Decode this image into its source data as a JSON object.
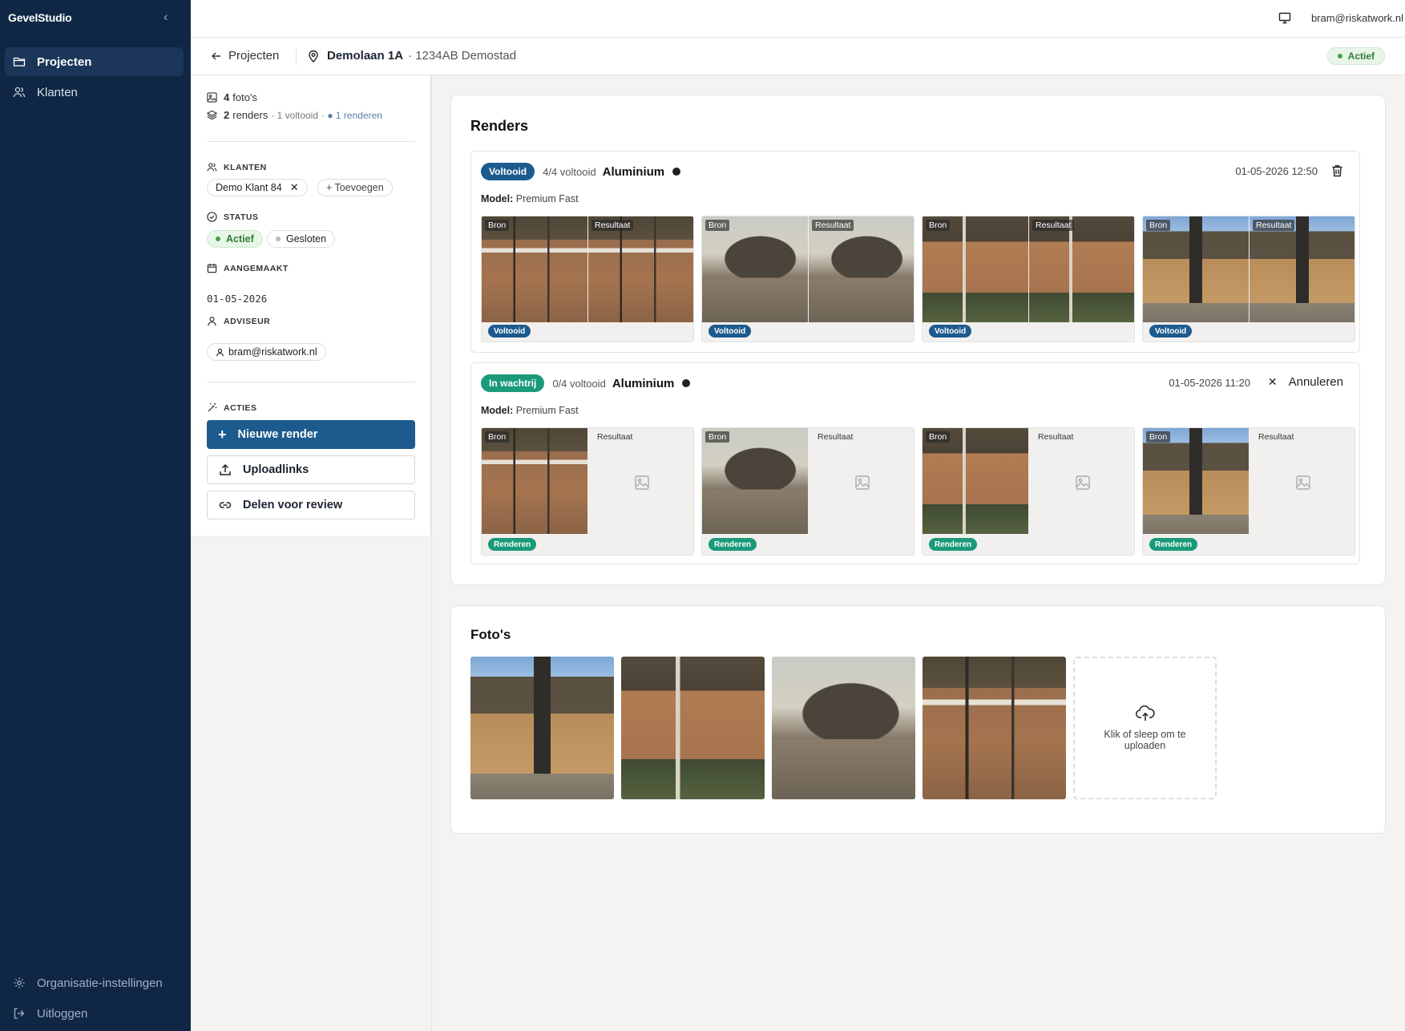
{
  "app": {
    "brand": "GevelStudio"
  },
  "sidebar": {
    "items": [
      {
        "label": "Projecten",
        "icon": "folder-icon",
        "active": true
      },
      {
        "label": "Klanten",
        "icon": "users-icon",
        "active": false
      }
    ],
    "bottom": [
      {
        "label": "Organisatie-instellingen",
        "icon": "gear-icon"
      },
      {
        "label": "Uitloggen",
        "icon": "logout-icon"
      }
    ]
  },
  "topbar": {
    "user_email": "bram@riskatwork.nl",
    "icon": "monitor-icon"
  },
  "breadcrumb": {
    "back_label": "Projecten",
    "address": "Demolaan 1A",
    "postal": "· 1234AB Demostad",
    "status": "Actief"
  },
  "info": {
    "photos_count": "4",
    "photos_label": "foto's",
    "renders_count": "2",
    "renders_label": "renders",
    "renders_done": "· 1 voltooid",
    "renders_busy": "· ● 1 renderen",
    "klanten_label": "KLANTEN",
    "klant_chip": "Demo Klant 84",
    "add_label": "+ Toevoegen",
    "status_label": "STATUS",
    "status_active": "Actief",
    "status_closed": "Gesloten",
    "created_label": "AANGEMAAKT",
    "created_value": "01-05-2026",
    "advisor_label": "ADVISEUR",
    "advisor_value": "bram@riskatwork.nl",
    "actions_label": "ACTIES",
    "action_new": "Nieuwe render",
    "action_upload": "Uploadlinks",
    "action_share": "Delen voor review"
  },
  "renders": {
    "title": "Renders",
    "blocks": [
      {
        "status": "Voltooid",
        "status_color": "#1d5b8f",
        "count": "4/4 voltooid",
        "material": "Aluminium",
        "date": "01-05-2026 12:50",
        "action_icon": "trash-icon",
        "model_label": "Model:",
        "model": "Premium Fast",
        "tile_status": "Voltooid",
        "tag_source": "Bron",
        "tag_result": "Resultaat"
      },
      {
        "status": "In wachtrij",
        "status_color": "#1a9a7a",
        "count": "0/4 voltooid",
        "material": "Aluminium",
        "date": "01-05-2026 11:20",
        "cancel_label": "Annuleren",
        "model_label": "Model:",
        "model": "Premium Fast",
        "tile_status": "Renderen",
        "tag_source": "Bron",
        "tag_result": "Resultaat"
      }
    ]
  },
  "photos": {
    "title": "Foto's",
    "upload_label": "Klik of sleep om te uploaden"
  }
}
